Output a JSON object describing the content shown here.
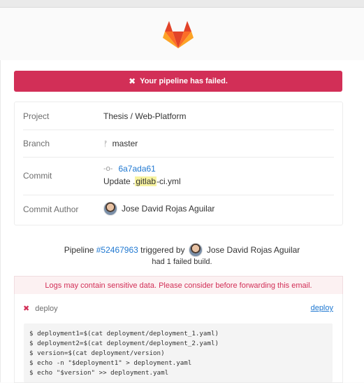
{
  "header": {
    "logo_icon": "gitlab-tanuki-icon"
  },
  "alert": {
    "icon": "close-icon",
    "text": "Your pipeline has failed."
  },
  "info": {
    "project": {
      "label": "Project",
      "value": "Thesis / Web-Platform"
    },
    "branch": {
      "label": "Branch",
      "icon": "branch-icon",
      "value": "master"
    },
    "commit": {
      "label": "Commit",
      "icon": "commit-icon",
      "sha": "6a7ada61",
      "message_before": "Update .",
      "message_highlight": "gitlab",
      "message_after": "-ci.yml"
    },
    "author": {
      "label": "Commit Author",
      "name": "Jose David Rojas Aguilar"
    }
  },
  "pipeline": {
    "prefix": "Pipeline ",
    "id": "#52467963",
    "triggered_by": " triggered by ",
    "user": "Jose David Rojas Aguilar",
    "summary": "had 1 failed build."
  },
  "warning": "Logs may contain sensitive data. Please consider before forwarding this email.",
  "job": {
    "status_icon": "close-icon",
    "name": "deploy",
    "stage": "deploy",
    "log": [
      "$ deployment1=$(cat deployment/deployment_1.yaml)",
      "$ deployment2=$(cat deployment/deployment_2.yaml)",
      "$ version=$(cat deployment/version)",
      "$ echo -n \"$deployment1\" > deployment.yaml",
      "$ echo \"$version\" >> deployment.yaml"
    ]
  },
  "colors": {
    "danger": "#d22f57",
    "link": "#1f78d1",
    "highlight": "#f7f3a0"
  }
}
